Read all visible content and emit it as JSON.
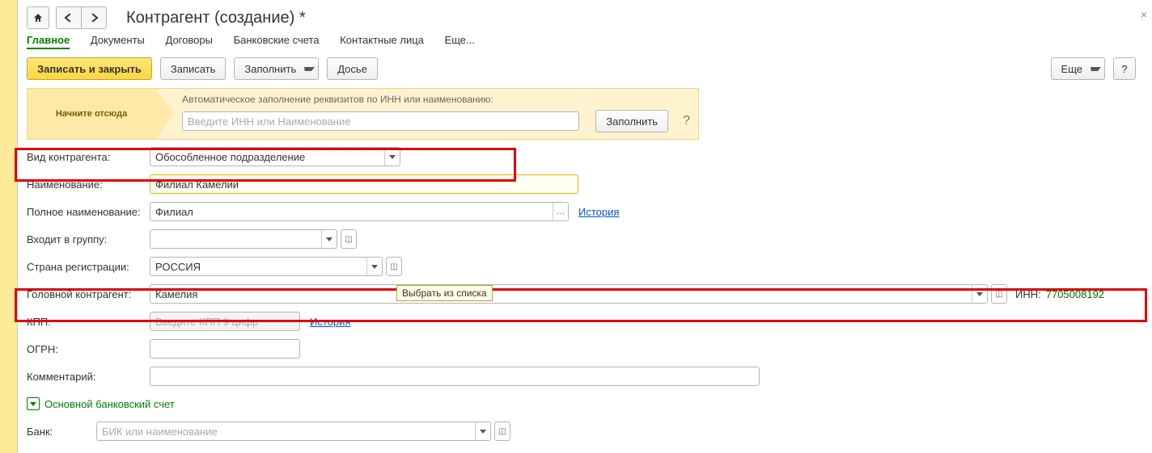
{
  "title": "Контрагент (создание) *",
  "tabs": {
    "main": "Главное",
    "docs": "Документы",
    "contracts": "Договоры",
    "bank": "Банковские счета",
    "contacts": "Контактные лица",
    "more": "Еще..."
  },
  "toolbar": {
    "save_close": "Записать и закрыть",
    "save": "Записать",
    "fill": "Заполнить",
    "dossier": "Досье",
    "more": "Еще"
  },
  "start": {
    "label": "Начните отсюда",
    "hint": "Автоматическое заполнение реквизитов по ИНН или наименованию:",
    "placeholder": "Введите ИНН или Наименование",
    "fill": "Заполнить",
    "help": "?"
  },
  "form": {
    "type": {
      "label": "Вид контрагента:",
      "value": "Обособленное подразделение"
    },
    "name": {
      "label": "Наименование:",
      "value": "Филиал Камелии"
    },
    "fullname": {
      "label": "Полное наименование:",
      "value": "Филиал",
      "history": "История"
    },
    "group": {
      "label": "Входит в группу:",
      "value": ""
    },
    "country": {
      "label": "Страна регистрации:",
      "value": "РОССИЯ"
    },
    "parent": {
      "label": "Головной контрагент:",
      "value": "Камелия",
      "tooltip": "Выбрать из списка",
      "inn_label": "ИНН:",
      "inn": "7705008192"
    },
    "kpp": {
      "label": "КПП:",
      "placeholder": "Введите КПП 9 цифр",
      "history": "История"
    },
    "ogrn": {
      "label": "ОГРН:"
    },
    "comment": {
      "label": "Комментарий:"
    },
    "bank_section": "Основной банковский счет",
    "bank": {
      "label": "Банк:",
      "placeholder": "БИК или наименование"
    }
  }
}
